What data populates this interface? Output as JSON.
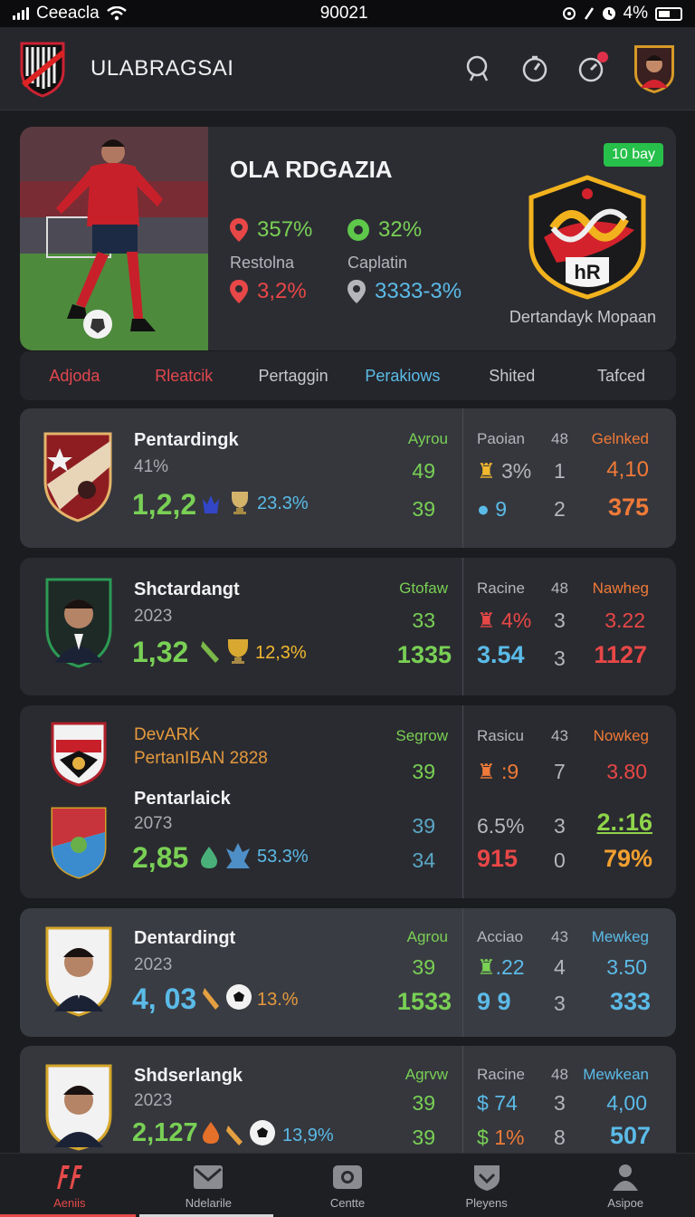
{
  "status": {
    "carrier": "Ceeacla",
    "time": "90021",
    "battery": "4%"
  },
  "header": {
    "title": "ULABRAGSAI"
  },
  "hero": {
    "name": "OLA RDGAZIA",
    "badge": "10 bay",
    "stat1": "357%",
    "stat2": "32%",
    "label1": "Restolna",
    "label2": "Caplatin",
    "stat3": "3,2%",
    "stat4": "3333-3%",
    "club_caption": "Dertandayk Mopaan"
  },
  "tabs": [
    {
      "label": "Adjoda",
      "color": "#e2474f"
    },
    {
      "label": "Rleatcik",
      "color": "#e2474f"
    },
    {
      "label": "Pertaggin",
      "color": "#c6c8cd"
    },
    {
      "label": "Perakiows",
      "color": "#5bbbe8"
    },
    {
      "label": "Shited",
      "color": "#c6c8cd"
    },
    {
      "label": "Tafced",
      "color": "#c6c8cd"
    }
  ],
  "cards": [
    {
      "name": "Pentardingk",
      "sub": "41%",
      "big": "1,2,2",
      "pct": "23.3%",
      "col1_head": "Ayrou",
      "col1_a": "49",
      "col1_b": "39",
      "col2_head": "Paoian",
      "col2_a": "3%",
      "col2_b": "9",
      "col3_head": "48",
      "col3_a": "1",
      "col3_b": "2",
      "col4_head": "Gelnked",
      "col4_a": "4,10",
      "col4_b": "375"
    },
    {
      "name": "Shctardangt",
      "sub": "2023",
      "big": "1,32",
      "pct": "12,3%",
      "col1_head": "Gtofaw",
      "col1_a": "33",
      "col1_b": "1335",
      "col2_head": "Racine",
      "col2_a": "4%",
      "col2_b": "3.54",
      "col3_head": "48",
      "col3_a": "3",
      "col3_b": "3",
      "col4_head": "Nawheg",
      "col4_a": "3.22",
      "col4_b": "1127"
    },
    {
      "title1": "DevARK",
      "title2": "PertanIBAN 2828",
      "name": "Pentarlaick",
      "sub": "2073",
      "big": "2,85",
      "pct": "53.3%",
      "col1_head": "Segrow",
      "col1_a": "39",
      "col1_b": "39",
      "col1_c": "34",
      "col2_head": "Rasicu",
      "col2_a": ":9",
      "col2_b": "6.5%",
      "col2_c": "915",
      "col3_head": "43",
      "col3_a": "7",
      "col3_b": "3",
      "col3_c": "0",
      "col4_head": "Nowkeg",
      "col4_a": "3.80",
      "col4_b": "2.:16",
      "col4_c": "79%"
    },
    {
      "name": "Dentardingt",
      "sub": "2023",
      "big": "4, 03",
      "pct": "13.%",
      "col1_head": "Agrou",
      "col1_a": "39",
      "col1_b": "1533",
      "col2_head": "Acciao",
      "col2_a": ".22",
      "col2_b": "9 9",
      "col3_head": "43",
      "col3_a": "4",
      "col3_b": "3",
      "col4_head": "Mewkeg",
      "col4_a": "3.50",
      "col4_b": "333"
    },
    {
      "name": "Shdserlangk",
      "sub": "2023",
      "big": "2,127",
      "pct": "13,9%",
      "col1_head": "Agrvw",
      "col1_a": "39",
      "col1_b": "39",
      "col2_head": "Racine",
      "col2_a": "74",
      "col2_b": "1%",
      "col3_head": "48",
      "col3_a": "3",
      "col3_b": "8",
      "col4_head": "Mewkean",
      "col4_a": "4,00",
      "col4_b": "507"
    }
  ],
  "nav": [
    {
      "label": "Aeniis",
      "icon": "ff-icon"
    },
    {
      "label": "Ndelarile",
      "icon": "mail-icon"
    },
    {
      "label": "Centte",
      "icon": "camera-icon"
    },
    {
      "label": "Pleyens",
      "icon": "shield-icon"
    },
    {
      "label": "Asipoe",
      "icon": "person-icon"
    }
  ]
}
